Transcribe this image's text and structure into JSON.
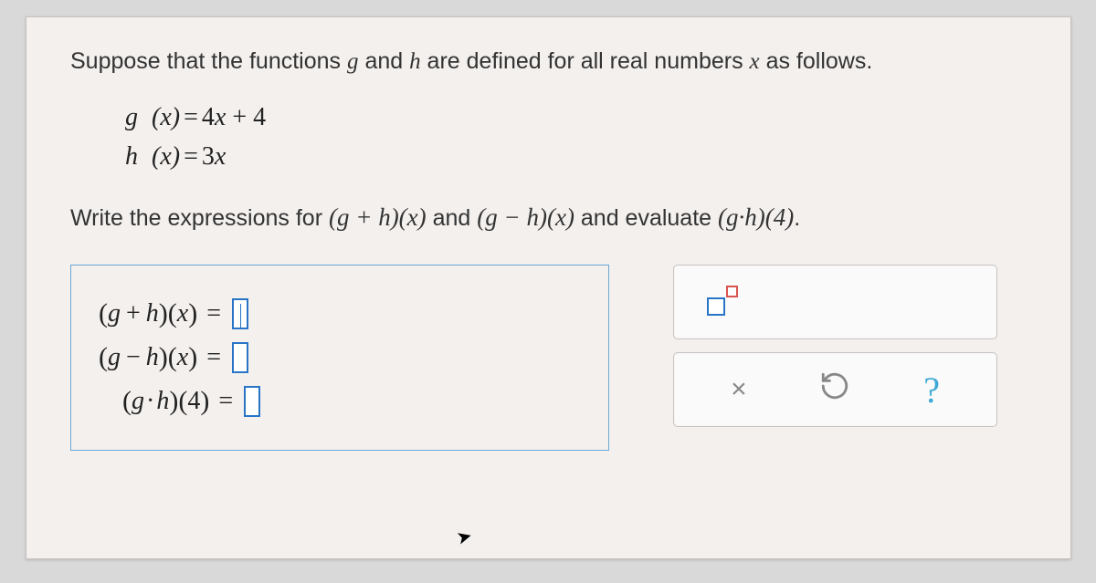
{
  "intro": {
    "pre": "Suppose that the functions ",
    "g": "g",
    "mid1": " and ",
    "h": "h",
    "mid2": " are defined for all real numbers ",
    "x": "x",
    "post": " as follows."
  },
  "defs": {
    "line1_left": "g",
    "line1_arg": "x",
    "line1_right": "4x + 4",
    "line2_left": "h",
    "line2_arg": "x",
    "line2_right": "3x",
    "eq": "="
  },
  "prompt": {
    "pre": "Write the expressions for ",
    "e1": "(g + h)(x)",
    "mid1": " and ",
    "e2": "(g − h)(x)",
    "mid2": " and evaluate ",
    "e3": "(g·h)(4)",
    "post": "."
  },
  "answers": {
    "row1_lhs": "(g + h)(x)",
    "row2_lhs": "(g − h)(x)",
    "row3_lhs": "(g·h)(4)",
    "eq": "="
  },
  "tools": {
    "exponent": "exponent",
    "clear": "×",
    "undo": "↺",
    "help": "?"
  }
}
